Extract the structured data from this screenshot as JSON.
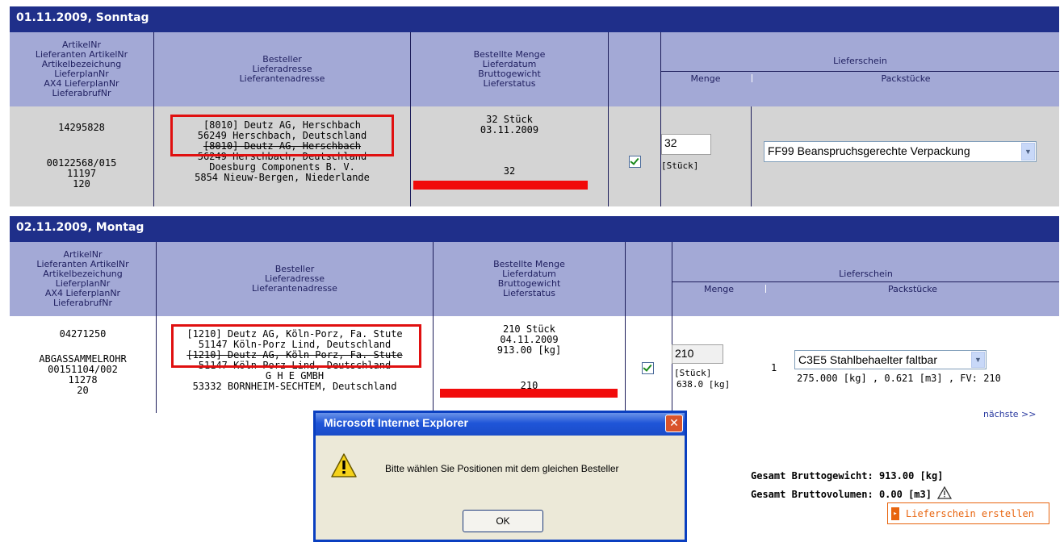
{
  "column_headers": {
    "artikel": [
      "ArtikelNr",
      "Lieferanten ArtikelNr",
      "Artikelbezeichung",
      "LieferplanNr",
      "AX4 LieferplanNr",
      "LieferabrufNr"
    ],
    "besteller": [
      "Besteller",
      "Lieferadresse",
      "Lieferantenadresse"
    ],
    "menge": [
      "Bestellte Menge",
      "Lieferdatum",
      "Bruttogewicht",
      "Lieferstatus"
    ],
    "lieferschein": "Lieferschein",
    "lieferschein_menge": "Menge",
    "lieferschein_pack": "Packstücke"
  },
  "day1": {
    "title": "01.11.2009, Sonntag",
    "artikel": [
      "14295828",
      "",
      "",
      "00122568/015",
      "11197",
      "120"
    ],
    "besteller": [
      "[8010] Deutz AG,  Herschbach",
      "56249 Herschbach,  Deutschland",
      "[8010] Deutz AG,  Herschbach",
      "56249 Herschbach,  Deutschland",
      "Doesburg Components B. V.",
      "5854 Nieuw-Bergen,  Niederlande"
    ],
    "bestellt": [
      "32 Stück",
      "03.11.2009"
    ],
    "status": "32",
    "lieferstatus_fraction": 1.0,
    "qty_value": "32",
    "qty_unit": "[Stück]",
    "pack_selected": "FF99 Beanspruchsgerechte Verpackung"
  },
  "day2": {
    "title": "02.11.2009, Montag",
    "artikel": [
      "04271250",
      "",
      "ABGASSAMMELROHR",
      "00151104/002",
      "11278",
      "20"
    ],
    "besteller": [
      "[1210] Deutz AG,  Köln-Porz, Fa. Stute",
      "51147 Köln-Porz Lind,  Deutschland",
      "[1210] Deutz AG,  Köln-Porz, Fa. Stute",
      "51147 Köln-Porz Lind,  Deutschland",
      "G H E GMBH",
      "53332 BORNHEIM-SECHTEM,  Deutschland"
    ],
    "bestellt": [
      "210 Stück",
      "04.11.2009",
      "913.00 [kg]"
    ],
    "status": "210",
    "lieferstatus_fraction": 1.0,
    "qty_value": "210",
    "qty_unit": "[Stück]",
    "qty_weight": "638.0 [kg]",
    "pack_count": "1",
    "pack_selected": "C3E5 Stahlbehaelter faltbar",
    "pack_info": "275.000 [kg] ,  0.621 [m3] , FV: 210"
  },
  "pager": {
    "next": "nächste >>"
  },
  "totals": {
    "gewicht_label": "Gesamt Bruttogewicht:",
    "gewicht_value": "913.00 [kg]",
    "volumen_label": "Gesamt Bruttovolumen:",
    "volumen_value": "0.00 [m3]"
  },
  "create_button": "Lieferschein erstellen",
  "dialog": {
    "title": "Microsoft Internet Explorer",
    "message": "Bitte wählen Sie Positionen mit dem gleichen Besteller",
    "ok": "OK"
  },
  "icons": [
    "warning-icon",
    "close-icon",
    "checkbox-checked-icon",
    "chevron-down-icon",
    "arrow-right-icon"
  ],
  "colors": {
    "header": "#1f2f8a",
    "column_header": "#a3a9d6",
    "row1_bg": "#d4d4d4",
    "status_bar": "#f10b0b",
    "highlight_box": "#e01010",
    "button_accent": "#e8640e"
  }
}
